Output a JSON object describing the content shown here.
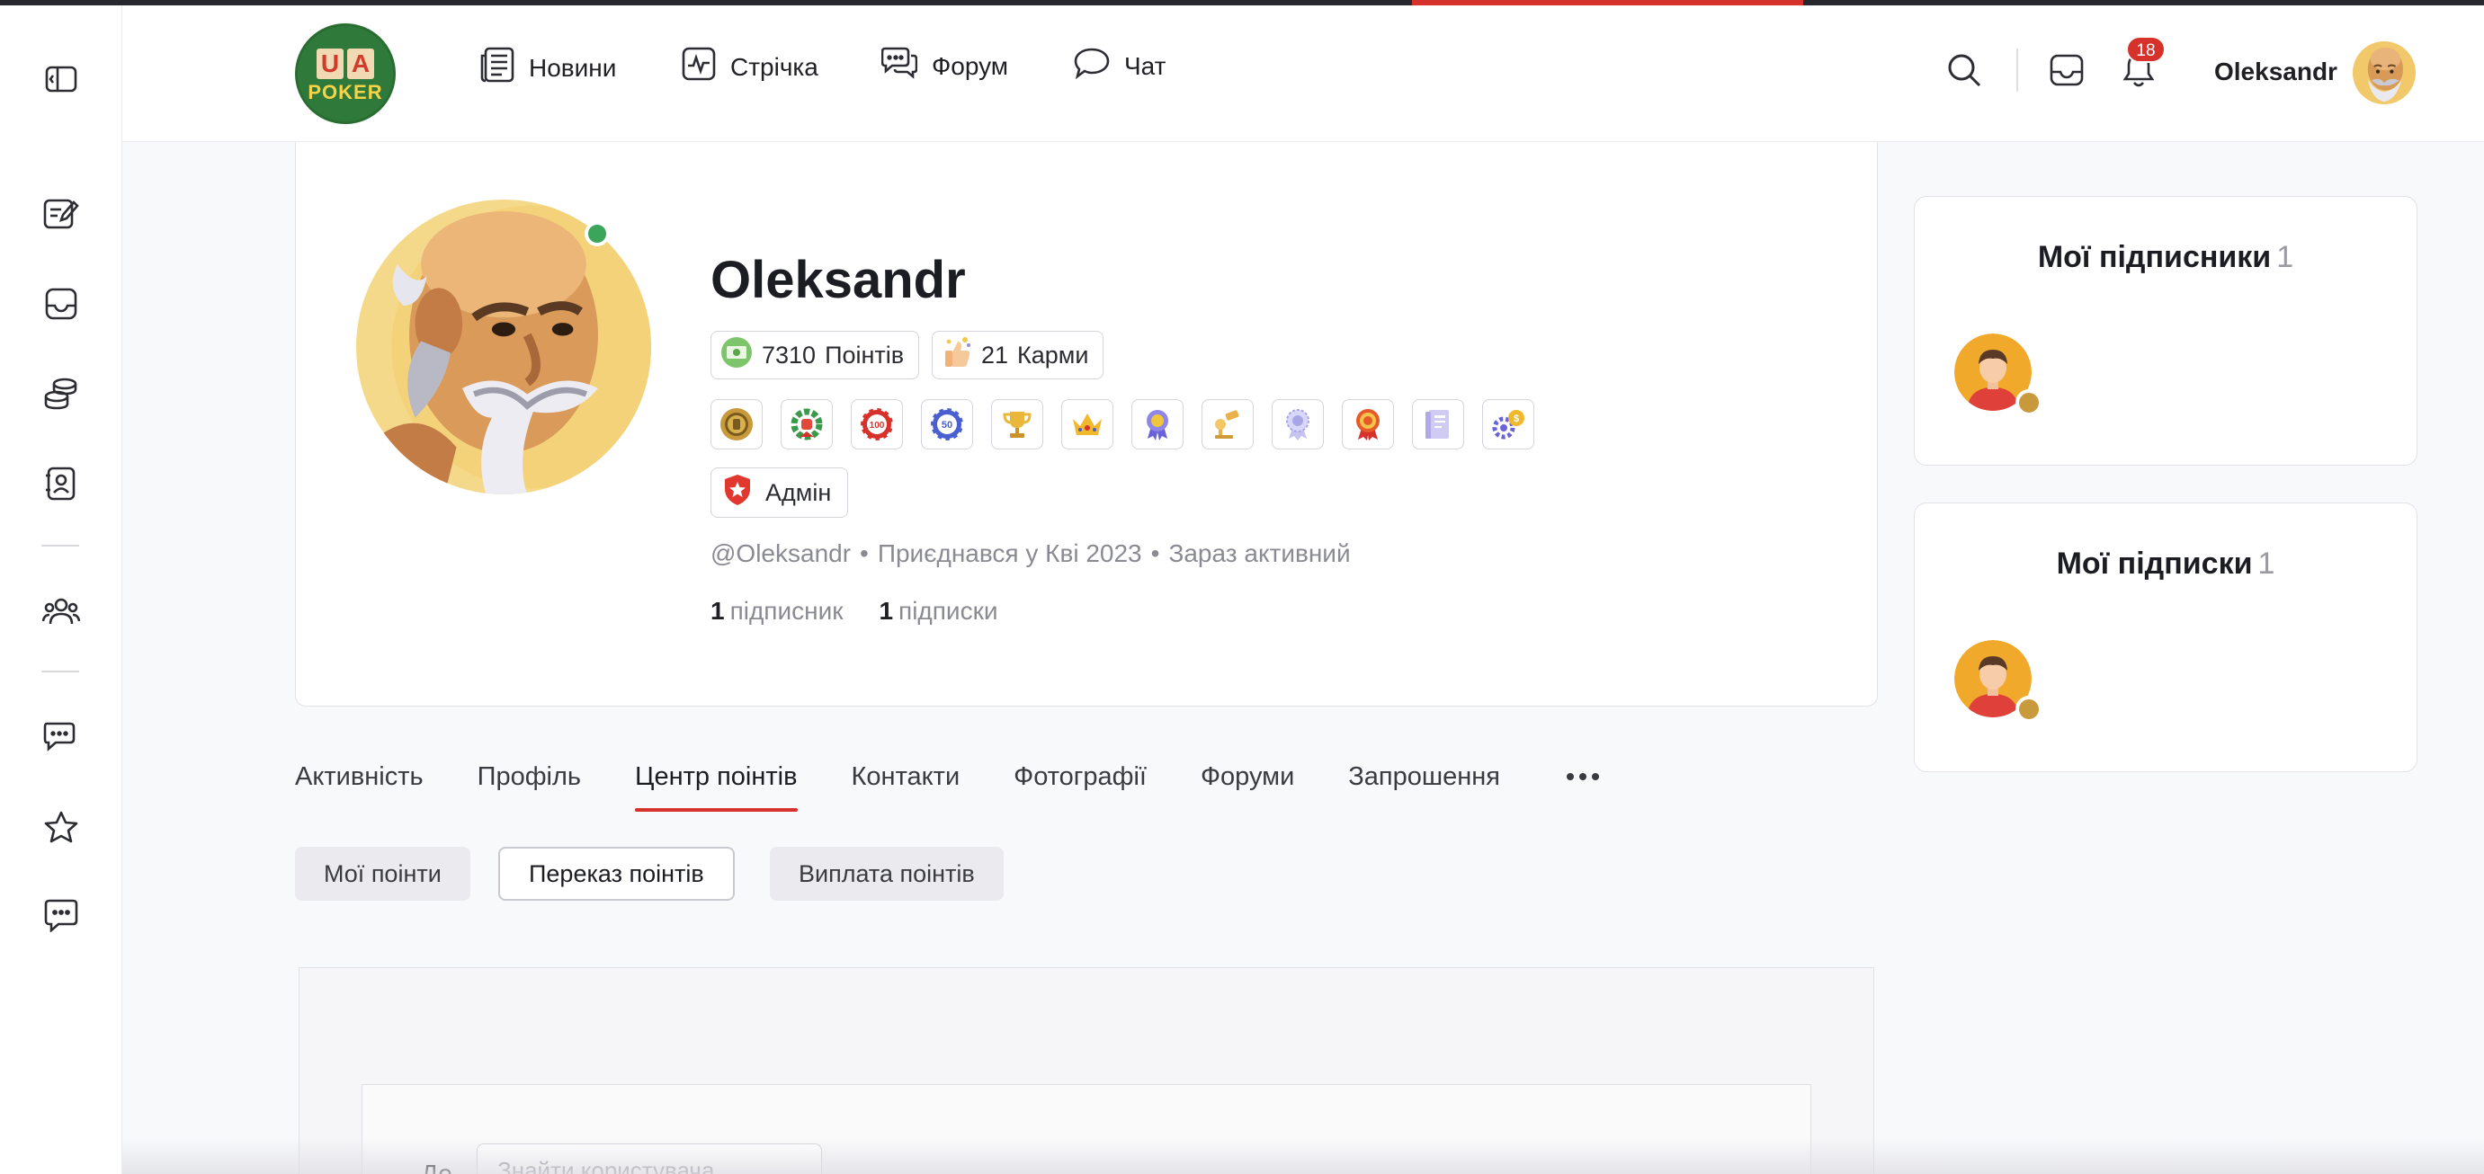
{
  "header": {
    "logo": {
      "letter_u": "U",
      "letter_a": "A",
      "word": "POKER"
    },
    "nav": [
      {
        "label": "Новини",
        "icon": "newspaper-icon"
      },
      {
        "label": "Стрічка",
        "icon": "activity-icon"
      },
      {
        "label": "Форум",
        "icon": "forum-bubbles-icon"
      },
      {
        "label": "Чат",
        "icon": "chat-bubble-icon"
      }
    ],
    "notifications_count": "18",
    "user_name": "Oleksandr"
  },
  "sidebar": {
    "items": [
      {
        "icon": "sidebar-toggle-icon"
      },
      {
        "icon": "blog-edit-icon"
      },
      {
        "icon": "inbox-icon"
      },
      {
        "icon": "coins-icon"
      },
      {
        "icon": "contact-book-icon"
      },
      {
        "icon": "members-icon"
      },
      {
        "icon": "forums-icon"
      },
      {
        "icon": "star-icon"
      },
      {
        "icon": "messages-icon"
      }
    ]
  },
  "profile": {
    "name": "Oleksandr",
    "points": {
      "value": "7310",
      "label": "Поінтів"
    },
    "karma": {
      "value": "21",
      "label": "Карми"
    },
    "achievements": [
      {
        "icon": "coin-achievement-icon",
        "color": "#b98a2e"
      },
      {
        "icon": "wreath-achievement-icon",
        "color": "#3a9a4a"
      },
      {
        "icon": "chip-100-achievement-icon",
        "text": "100",
        "color": "#d6322b"
      },
      {
        "icon": "chip-50-achievement-icon",
        "text": "50",
        "color": "#4a5fd0"
      },
      {
        "icon": "trophy-achievement-icon",
        "color": "#e0a92a"
      },
      {
        "icon": "crown-achievement-icon",
        "color": "#e7a928"
      },
      {
        "icon": "ribbon-achievement-icon",
        "color": "#6a62d8"
      },
      {
        "icon": "gavel-achievement-icon",
        "color": "#eab04a"
      },
      {
        "icon": "medal-achievement-icon",
        "color": "#a9a6e8"
      },
      {
        "icon": "award-achievement-icon",
        "color": "#e65a2a"
      },
      {
        "icon": "book-achievement-icon",
        "color": "#b9b4ea"
      },
      {
        "icon": "gears-achievement-icon",
        "color": "#6a62d8"
      }
    ],
    "role": "Адмін",
    "handle": "@Oleksandr",
    "joined": "Приєднався у Кві 2023",
    "status": "Зараз активний",
    "followers_count": "1",
    "followers_label": "підписник",
    "following_count": "1",
    "following_label": "підписки"
  },
  "tabs": [
    "Активність",
    "Профіль",
    "Центр поінтів",
    "Контакти",
    "Фотографії",
    "Форуми",
    "Запрошення"
  ],
  "active_tab": "Центр поінтів",
  "subtabs": [
    "Мої поінти",
    "Переказ поінтів",
    "Виплата поінтів"
  ],
  "active_subtab": "Переказ поінтів",
  "transfer_form": {
    "to_label": "До",
    "to_placeholder": "Знайти користувача..."
  },
  "side": {
    "followers_title": "Мої підписники",
    "followers_count": "1",
    "following_title": "Мої підписки",
    "following_count": "1"
  },
  "colors": {
    "accent": "#d6322b",
    "online": "#3ba55c",
    "logo_green": "#2f7a3a"
  }
}
